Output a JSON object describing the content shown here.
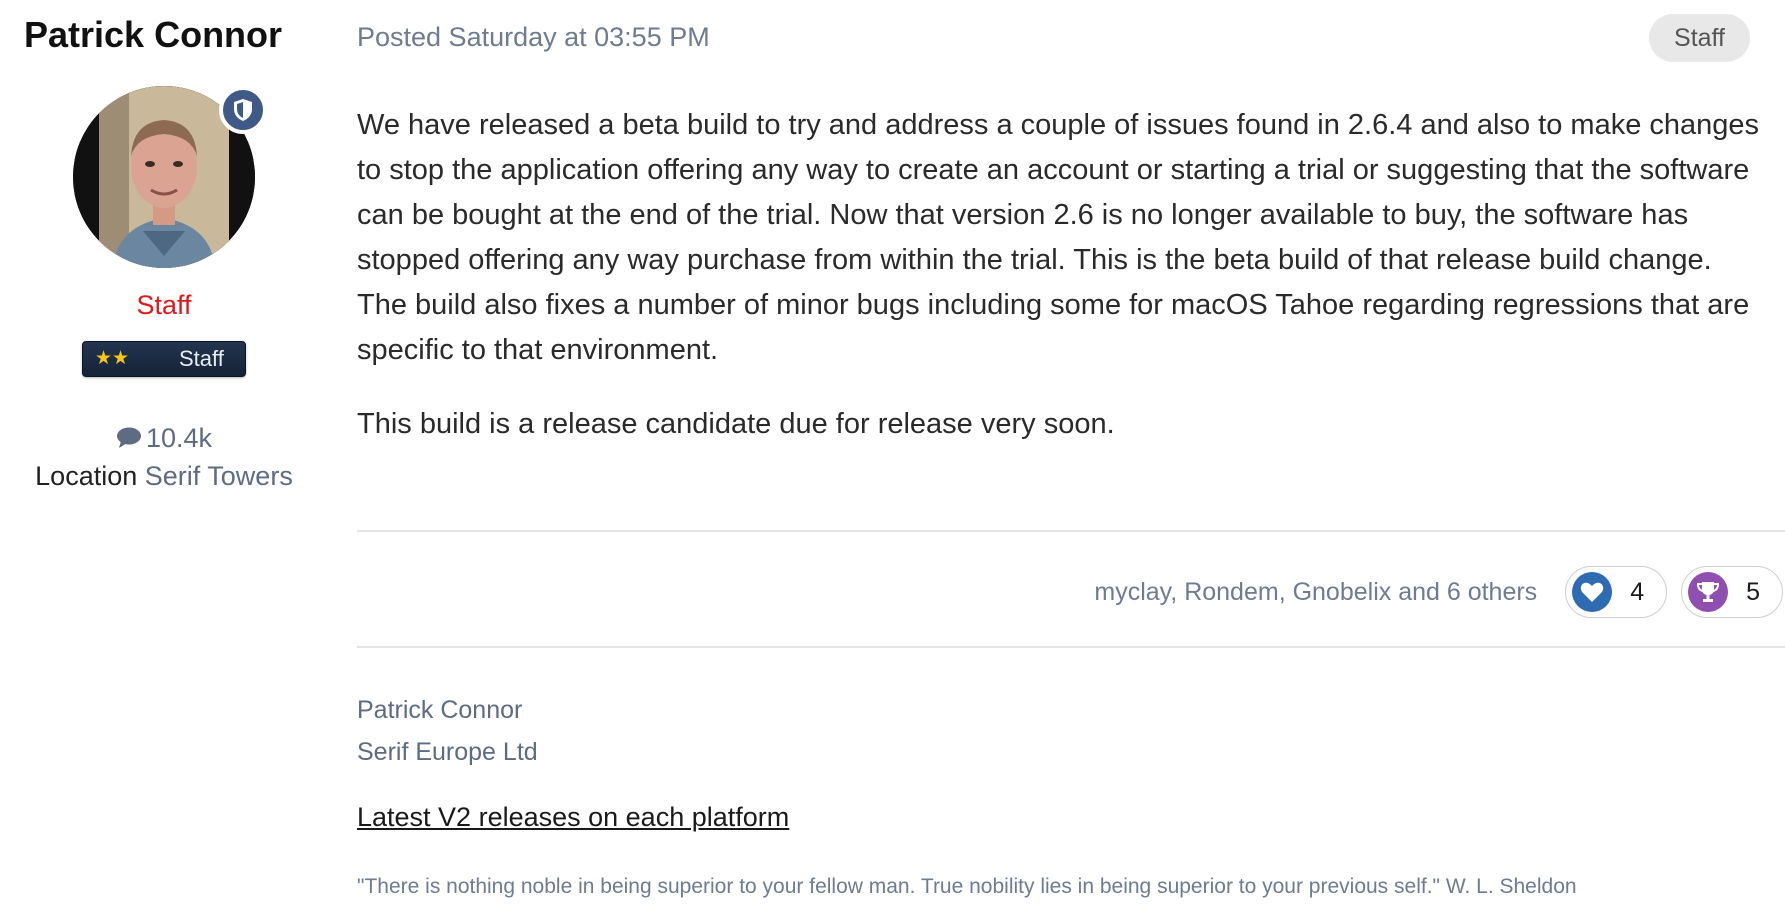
{
  "author": {
    "name": "Patrick Connor",
    "group": "Staff",
    "rank_label": "Staff",
    "rank_stars": "★★",
    "post_count": "10.4k",
    "location_label": "Location",
    "location_value": "Serif Towers"
  },
  "post": {
    "meta": "Posted Saturday at 03:55 PM",
    "staff_badge": "Staff",
    "paragraphs": [
      "We have released a beta build to try and address a couple of issues found in 2.6.4 and also to make changes to stop the application offering any way to create an account or starting a trial or suggesting that the software can be bought at the end of the trial. Now that version 2.6 is no longer available to buy, the software has stopped offering any way purchase from within the trial. This is the beta build of that release build change.",
      "The build also fixes a number of minor bugs including some for macOS Tahoe regarding regressions that are specific to that environment.",
      "This build is a release candidate due for release very soon."
    ]
  },
  "reactions": {
    "users_text": "myclay, Rondem, Gnobelix and 6 others",
    "items": [
      {
        "icon": "heart-icon",
        "color": "#2f6bb3",
        "count": "4"
      },
      {
        "icon": "trophy-icon",
        "color": "#8e4fb0",
        "count": "5"
      }
    ]
  },
  "signature": {
    "name": "Patrick Connor",
    "company": "Serif Europe Ltd",
    "link_text": "Latest V2 releases on each platform",
    "quote": "\"There is nothing noble in being superior to your fellow man. True nobility lies in being superior to your previous self.\"  W. L. Sheldon"
  },
  "colors": {
    "group_color": "#e0181b",
    "meta_text": "#6f7b91",
    "rank_bg": "#1b2a42",
    "mod_badge": "#3f5a86"
  }
}
